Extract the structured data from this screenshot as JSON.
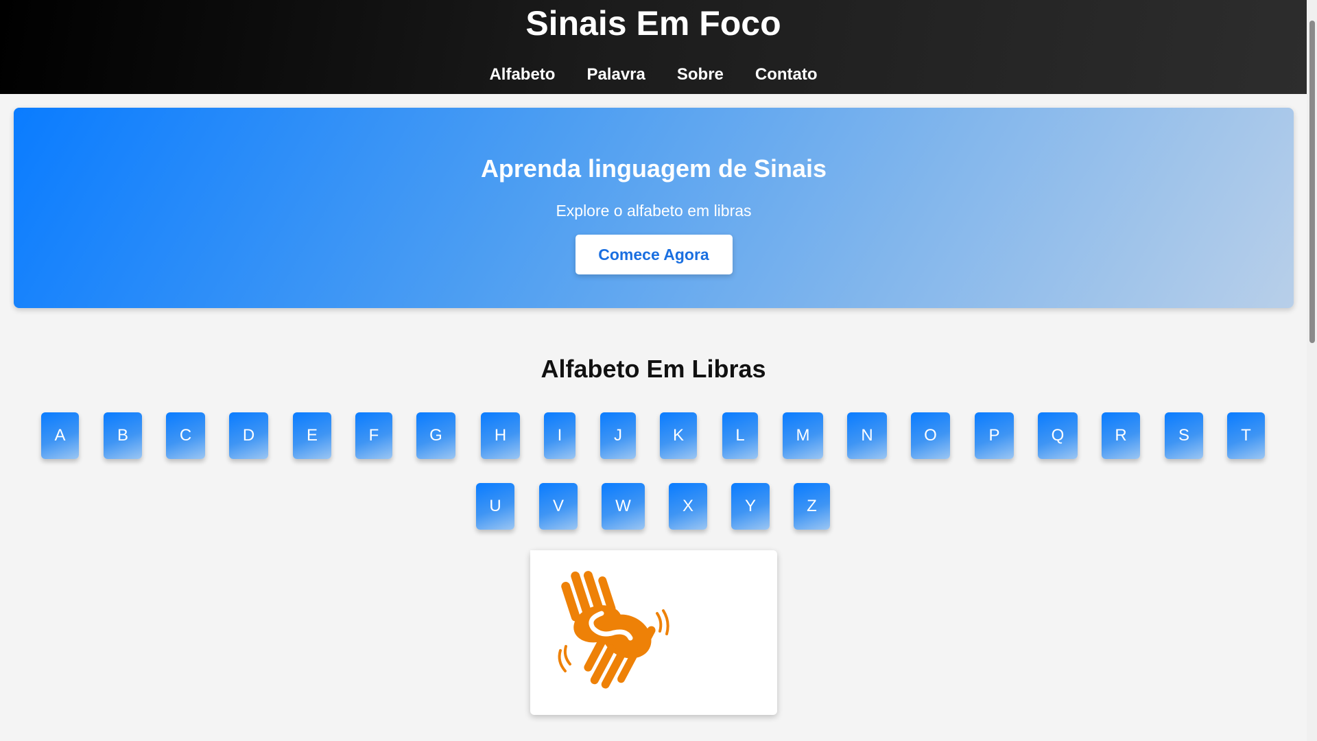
{
  "header": {
    "title": "Sinais Em Foco",
    "nav": [
      "Alfabeto",
      "Palavra",
      "Sobre",
      "Contato"
    ]
  },
  "hero": {
    "title": "Aprenda linguagem de Sinais",
    "subtitle": "Explore o alfabeto em libras",
    "button": "Comece Agora"
  },
  "alphabet": {
    "title": "Alfabeto Em Libras",
    "letters": [
      "A",
      "B",
      "C",
      "D",
      "E",
      "F",
      "G",
      "H",
      "I",
      "J",
      "K",
      "L",
      "M",
      "N",
      "O",
      "P",
      "Q",
      "R",
      "S",
      "T",
      "U",
      "V",
      "W",
      "X",
      "Y",
      "Z"
    ]
  },
  "colors": {
    "accent": "#0a7cff",
    "sign_orange": "#ee8107"
  },
  "icons": {
    "sign_image": "hands-sign-language-icon"
  }
}
